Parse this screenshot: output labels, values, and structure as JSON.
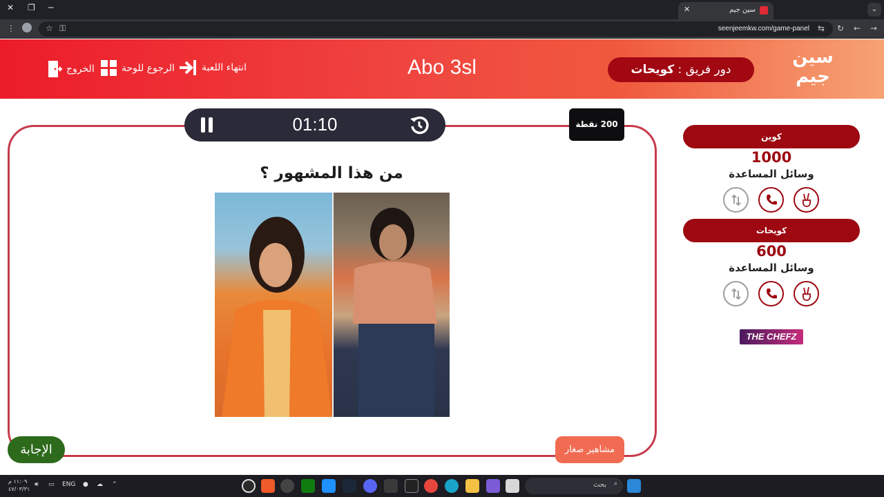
{
  "browser": {
    "tab_title": "سين جيم",
    "url": "seenjeemkw.com/game-panel"
  },
  "header": {
    "logo_text": "سين جيم",
    "turn_prefix": "دور فريق : ",
    "turn_team": "كويحات",
    "game_title": "Abo 3sl",
    "end_game": "انتهاء اللعبة",
    "back_to_board": "الرجوع للوحة",
    "exit": "الخروج"
  },
  "timer": {
    "time": "01:10"
  },
  "points_label": "200 نقطة",
  "question": "من هذا المشهور ؟",
  "answer_button": "الإجابة",
  "category": "مشاهير صغار",
  "teams": [
    {
      "name": "كوين",
      "score": "1000",
      "help_label": "وسائل المساعدة"
    },
    {
      "name": "كويحات",
      "score": "600",
      "help_label": "وسائل المساعدة"
    }
  ],
  "sponsor": "THE CHEFZ",
  "taskbar": {
    "search_label": "بحث",
    "lang": "ENG",
    "time": "١١:٠٩ م",
    "date": "٤٧/٠٣/٣١"
  },
  "colors": {
    "header_red": "#ec1c2a",
    "team_pill": "#9d0811",
    "card_border": "#c73a4a",
    "answer_green": "#2d6a1c",
    "category_orange": "#f06b52"
  }
}
